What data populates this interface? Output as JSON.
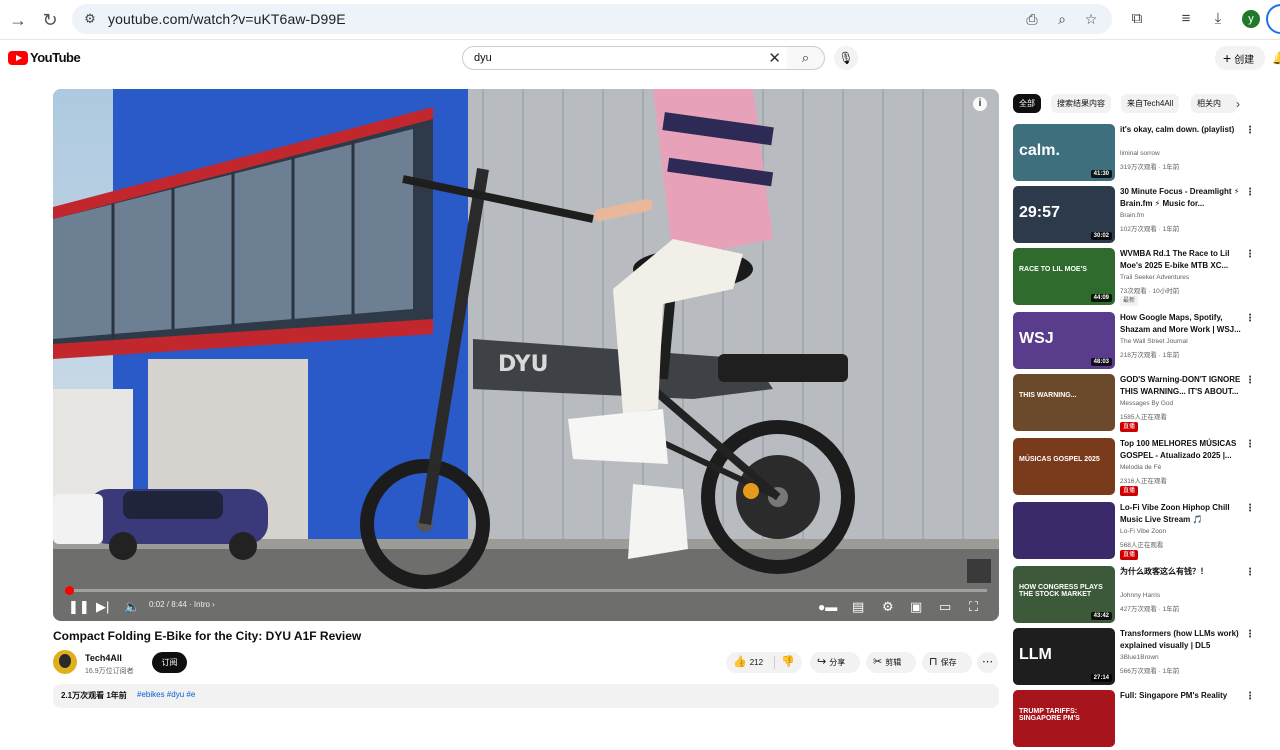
{
  "browser": {
    "url": "youtube.com/watch?v=uKT6aw-D99E",
    "profile_initial": "y"
  },
  "header": {
    "logo_text": "YouTube",
    "search_query": "dyu",
    "create_label": "创建"
  },
  "player": {
    "time": "0:02 / 8:44",
    "chapter": "Intro",
    "progress_fraction": 0.004,
    "scene_text": "DYU"
  },
  "video": {
    "title": "Compact Folding E-Bike for the City: DYU A1F Review",
    "channel": "Tech4All",
    "subscribers": "16.9万位订阅者",
    "subscribe_label": "订阅",
    "likes": "212",
    "share_label": "分享",
    "clip_label": "剪辑",
    "save_label": "保存",
    "views_date": "2.1万次观看  1年前",
    "tags": "#ebikes #dyu #e"
  },
  "chips": [
    {
      "label": "全部"
    },
    {
      "label": "搜索结果内容"
    },
    {
      "label": "来自Tech4All"
    },
    {
      "label": "相关内"
    }
  ],
  "recommendations": [
    {
      "title": "it's okay, calm down. (playlist)",
      "channel": "liminal sorrow",
      "meta": "319万次观看 · 1年前",
      "duration": "41:30",
      "thumb_text": "calm.",
      "bg": "#3d6f7d",
      "badge": ""
    },
    {
      "title": "30 Minute Focus - Dreamlight ⚡ Brain.fm ⚡ Music for...",
      "channel": "Brain.fm",
      "meta": "102万次观看 · 1年前",
      "duration": "30:02",
      "thumb_text": "29:57",
      "bg": "#2c3a4c",
      "badge": ""
    },
    {
      "title": "WVMBA Rd.1 The Race to Lil Moe's 2025 E-bike MTB XC...",
      "channel": "Trail Seeker Adventures",
      "meta": "73次观看 · 10小时前",
      "duration": "44:09",
      "thumb_text": "RACE TO LIL MOE'S",
      "bg": "#2f6b2c",
      "badge": "最新"
    },
    {
      "title": "How Google Maps, Spotify, Shazam and More Work | WSJ...",
      "channel": "The Wall Street Journal",
      "meta": "218万次观看 · 1年前",
      "duration": "48:03",
      "thumb_text": "WSJ",
      "bg": "#5a3c8c",
      "badge": ""
    },
    {
      "title": "GOD'S Warning-DON'T IGNORE THIS WARNING... IT'S ABOUT...",
      "channel": "Messages By God",
      "meta": "1585人正在观看",
      "duration": "",
      "thumb_text": "THIS WARNING...",
      "bg": "#6a4a2a",
      "badge": "直播"
    },
    {
      "title": "Top 100 MELHORES MÚSICAS GOSPEL - Atualizado 2025 |...",
      "channel": "Melodia de Fé",
      "meta": "2316人正在观看",
      "duration": "",
      "thumb_text": "MÚSICAS GOSPEL 2025",
      "bg": "#7a3a1c",
      "badge": "直播"
    },
    {
      "title": "Lo-Fi Vibe Zoon Hiphop Chill Music Live Stream 🎵",
      "channel": "Lo-Fi Vibe Zoon",
      "meta": "568人正在观看",
      "duration": "",
      "thumb_text": "",
      "bg": "#3a2a6a",
      "badge": "直播"
    },
    {
      "title": "为什么政客这么有钱？！",
      "channel": "Johnny Harris",
      "meta": "427万次观看 · 1年前",
      "duration": "43:42",
      "thumb_text": "HOW CONGRESS PLAYS THE STOCK MARKET",
      "bg": "#3c5a3a",
      "badge": ""
    },
    {
      "title": "Transformers (how LLMs work) explained visually | DL5",
      "channel": "3Blue1Brown",
      "meta": "566万次观看 · 1年前",
      "duration": "27:14",
      "thumb_text": "LLM",
      "bg": "#1e1e1e",
      "badge": ""
    },
    {
      "title": "Full: Singapore PM's Reality",
      "channel": "",
      "meta": "",
      "duration": "",
      "thumb_text": "TRUMP TARIFFS: SINGAPORE PM'S",
      "bg": "#a8141c",
      "badge": ""
    }
  ]
}
